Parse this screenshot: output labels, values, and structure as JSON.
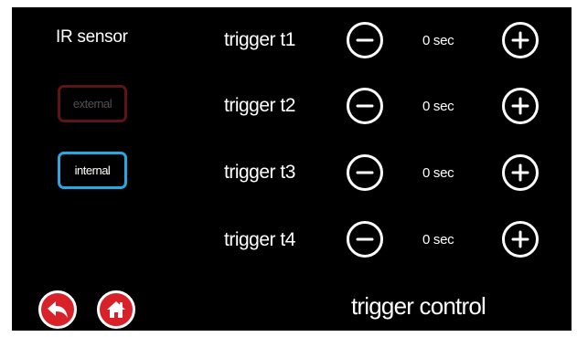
{
  "sensor": {
    "title": "IR sensor",
    "options": [
      {
        "label": "external",
        "selected": false,
        "border_color": "#5e1318"
      },
      {
        "label": "internal",
        "selected": true,
        "border_color": "#2aa7e0"
      }
    ]
  },
  "triggers": [
    {
      "label": "trigger t1",
      "value": "0 sec"
    },
    {
      "label": "trigger t2",
      "value": "0 sec"
    },
    {
      "label": "trigger t3",
      "value": "0 sec"
    },
    {
      "label": "trigger t4",
      "value": "0 sec"
    }
  ],
  "icons": {
    "decrement": "minus-circle-icon",
    "increment": "plus-circle-icon",
    "back": "back-arrow-icon",
    "home": "home-icon"
  },
  "footer": {
    "title": "trigger control"
  },
  "colors": {
    "background": "#000000",
    "accent_blue": "#2aa7e0",
    "accent_red": "#d82128",
    "inactive_border": "#5e1318"
  }
}
